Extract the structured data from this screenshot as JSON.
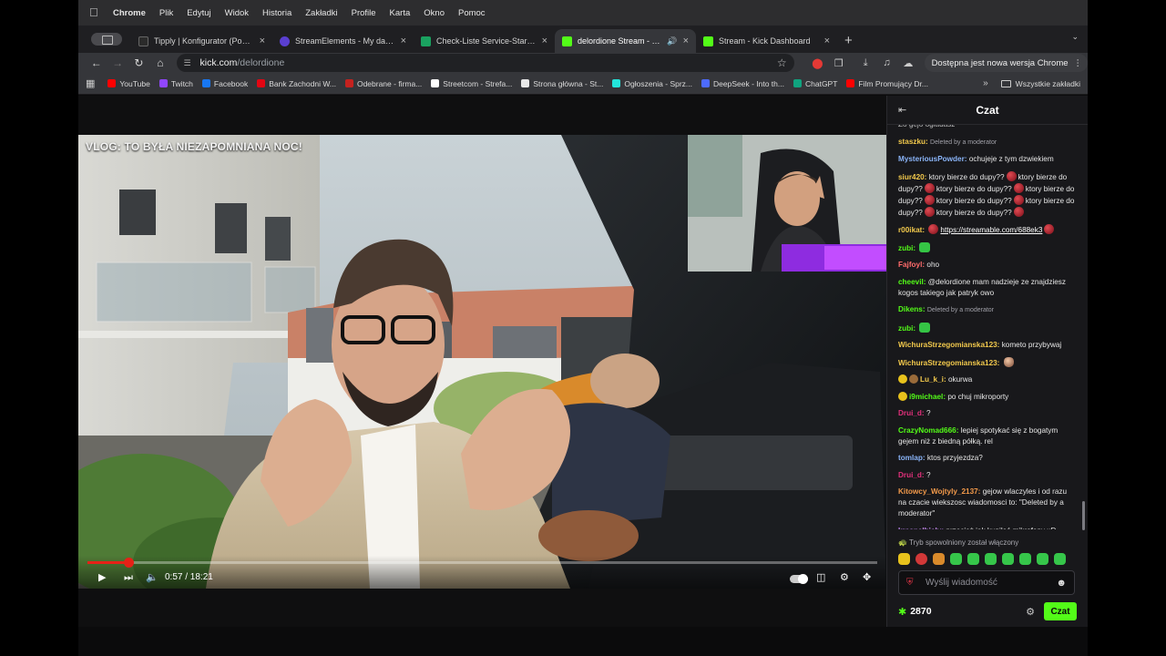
{
  "menubar": {
    "app": "Chrome",
    "items": [
      "Plik",
      "Edytuj",
      "Widok",
      "Historia",
      "Zakładki",
      "Profile",
      "Karta",
      "Okno",
      "Pomoc"
    ]
  },
  "tabs": [
    {
      "title": "Tipply | Konfigurator (Powiadomienia)",
      "favicon_color": "#2b2b2b",
      "active": false
    },
    {
      "title": "StreamElements - My dashboard",
      "favicon_color": "#5a3fd1",
      "active": false
    },
    {
      "title": "Check-Liste Service-Start-Abo",
      "favicon_color": "#1aa260",
      "active": false
    },
    {
      "title": "delordione Stream - Watch Live",
      "favicon_color": "#53fc18",
      "active": true
    },
    {
      "title": "Stream - Kick Dashboard",
      "favicon_color": "#53fc18",
      "active": false
    }
  ],
  "address": {
    "host": "kick.com",
    "path": "/delordione"
  },
  "update_button": "Dostępna jest nowa wersja Chrome",
  "bookmarks": [
    {
      "label": "YouTube",
      "color": "#ff0000"
    },
    {
      "label": "Twitch",
      "color": "#9146ff"
    },
    {
      "label": "Facebook",
      "color": "#1877f2"
    },
    {
      "label": "Bank Zachodni W...",
      "color": "#e30613"
    },
    {
      "label": "Odebrane - firma...",
      "color": "#c5221f"
    },
    {
      "label": "Streetcom - Strefa...",
      "color": "#ffffff"
    },
    {
      "label": "Strona główna - St...",
      "color": "#e8e8e8"
    },
    {
      "label": "Ogłoszenia - Sprz...",
      "color": "#23e5db"
    },
    {
      "label": "DeepSeek - Into th...",
      "color": "#4d6bfe"
    },
    {
      "label": "ChatGPT",
      "color": "#10a37f"
    },
    {
      "label": "Film Promujący Dr...",
      "color": "#ff0000"
    }
  ],
  "bookmarks_all": "Wszystkie zakładki",
  "video": {
    "title": "VLOG: TO BYŁA NIEZAPOMNIANA NOC!",
    "time": "0:57 / 18:21",
    "progress": 0.0518
  },
  "chat": {
    "title": "Czat",
    "messages": [
      {
        "user": "",
        "color": "#e6e6e6",
        "text": "Zo gejo ogladasz",
        "partial": true
      },
      {
        "user": "staszku:",
        "color": "#f2c94c",
        "deleted": "Deleted by a moderator"
      },
      {
        "user": "MysteriousPowder:",
        "color": "#8ab4f8",
        "text": "ochujeje z tym dzwiekiem"
      },
      {
        "user": "siur420:",
        "color": "#f2c94c",
        "text": "ktory bierze do dupy??",
        "repeat": 7
      },
      {
        "user": "r00ikat:",
        "color": "#f2c94c",
        "link": "https://streamable.com/688ek3"
      },
      {
        "user": "zubi:",
        "color": "#53fc18",
        "emote": "green"
      },
      {
        "user": "Fajfoyl:",
        "color": "#ff6b6b",
        "text": "oho"
      },
      {
        "user": "cheevil:",
        "color": "#53fc18",
        "text": "@delordione mam nadzieje ze znajdziesz kogos takiego jak patryk owo"
      },
      {
        "user": "Dikens:",
        "color": "#53fc18",
        "deleted": "Deleted by a moderator"
      },
      {
        "user": "zubi:",
        "color": "#53fc18",
        "emote": "green"
      },
      {
        "user": "WichuraStrzegomianska123:",
        "color": "#f2c94c",
        "text": "kometo przybywaj"
      },
      {
        "user": "WichuraStrzegomianska123:",
        "color": "#f2c94c",
        "emote": "face"
      },
      {
        "user": "Lu_k_i:",
        "color": "#f2c94c",
        "text": "okurwa",
        "badges": 2
      },
      {
        "user": "i9michael:",
        "color": "#53fc18",
        "text": "po chuj mikroporty",
        "badges": 1
      },
      {
        "user": "Drui_d:",
        "color": "#e0307a",
        "text": "?"
      },
      {
        "user": "CrazyNomad666:",
        "color": "#53fc18",
        "text": "lepiej spotykać się z bogatym gejem niż z biedną półką. rel"
      },
      {
        "user": "tomlap:",
        "color": "#8ab4f8",
        "text": "ktos przyjezdza?"
      },
      {
        "user": "Drui_d:",
        "color": "#e0307a",
        "text": "?"
      },
      {
        "user": "Kitowcy_Wojtyly_2137:",
        "color": "#f2994a",
        "text": "gejow wlaczyles i od razu na czacie wiekszosc wiadomosci to: \"Deleted by a moderator\""
      },
      {
        "user": "krasnalbialy:",
        "color": "#c58af9",
        "text": "przecież jak kupiłeś mikrofony xD"
      }
    ],
    "slow_mode": "Tryb spowolniony został włączony",
    "input_placeholder": "Wyślij wiadomość",
    "points": "2870",
    "send_label": "Czat"
  },
  "colors": {
    "kick_green": "#53fc18",
    "chat_bg": "#18181b",
    "progress_red": "#e62117"
  }
}
